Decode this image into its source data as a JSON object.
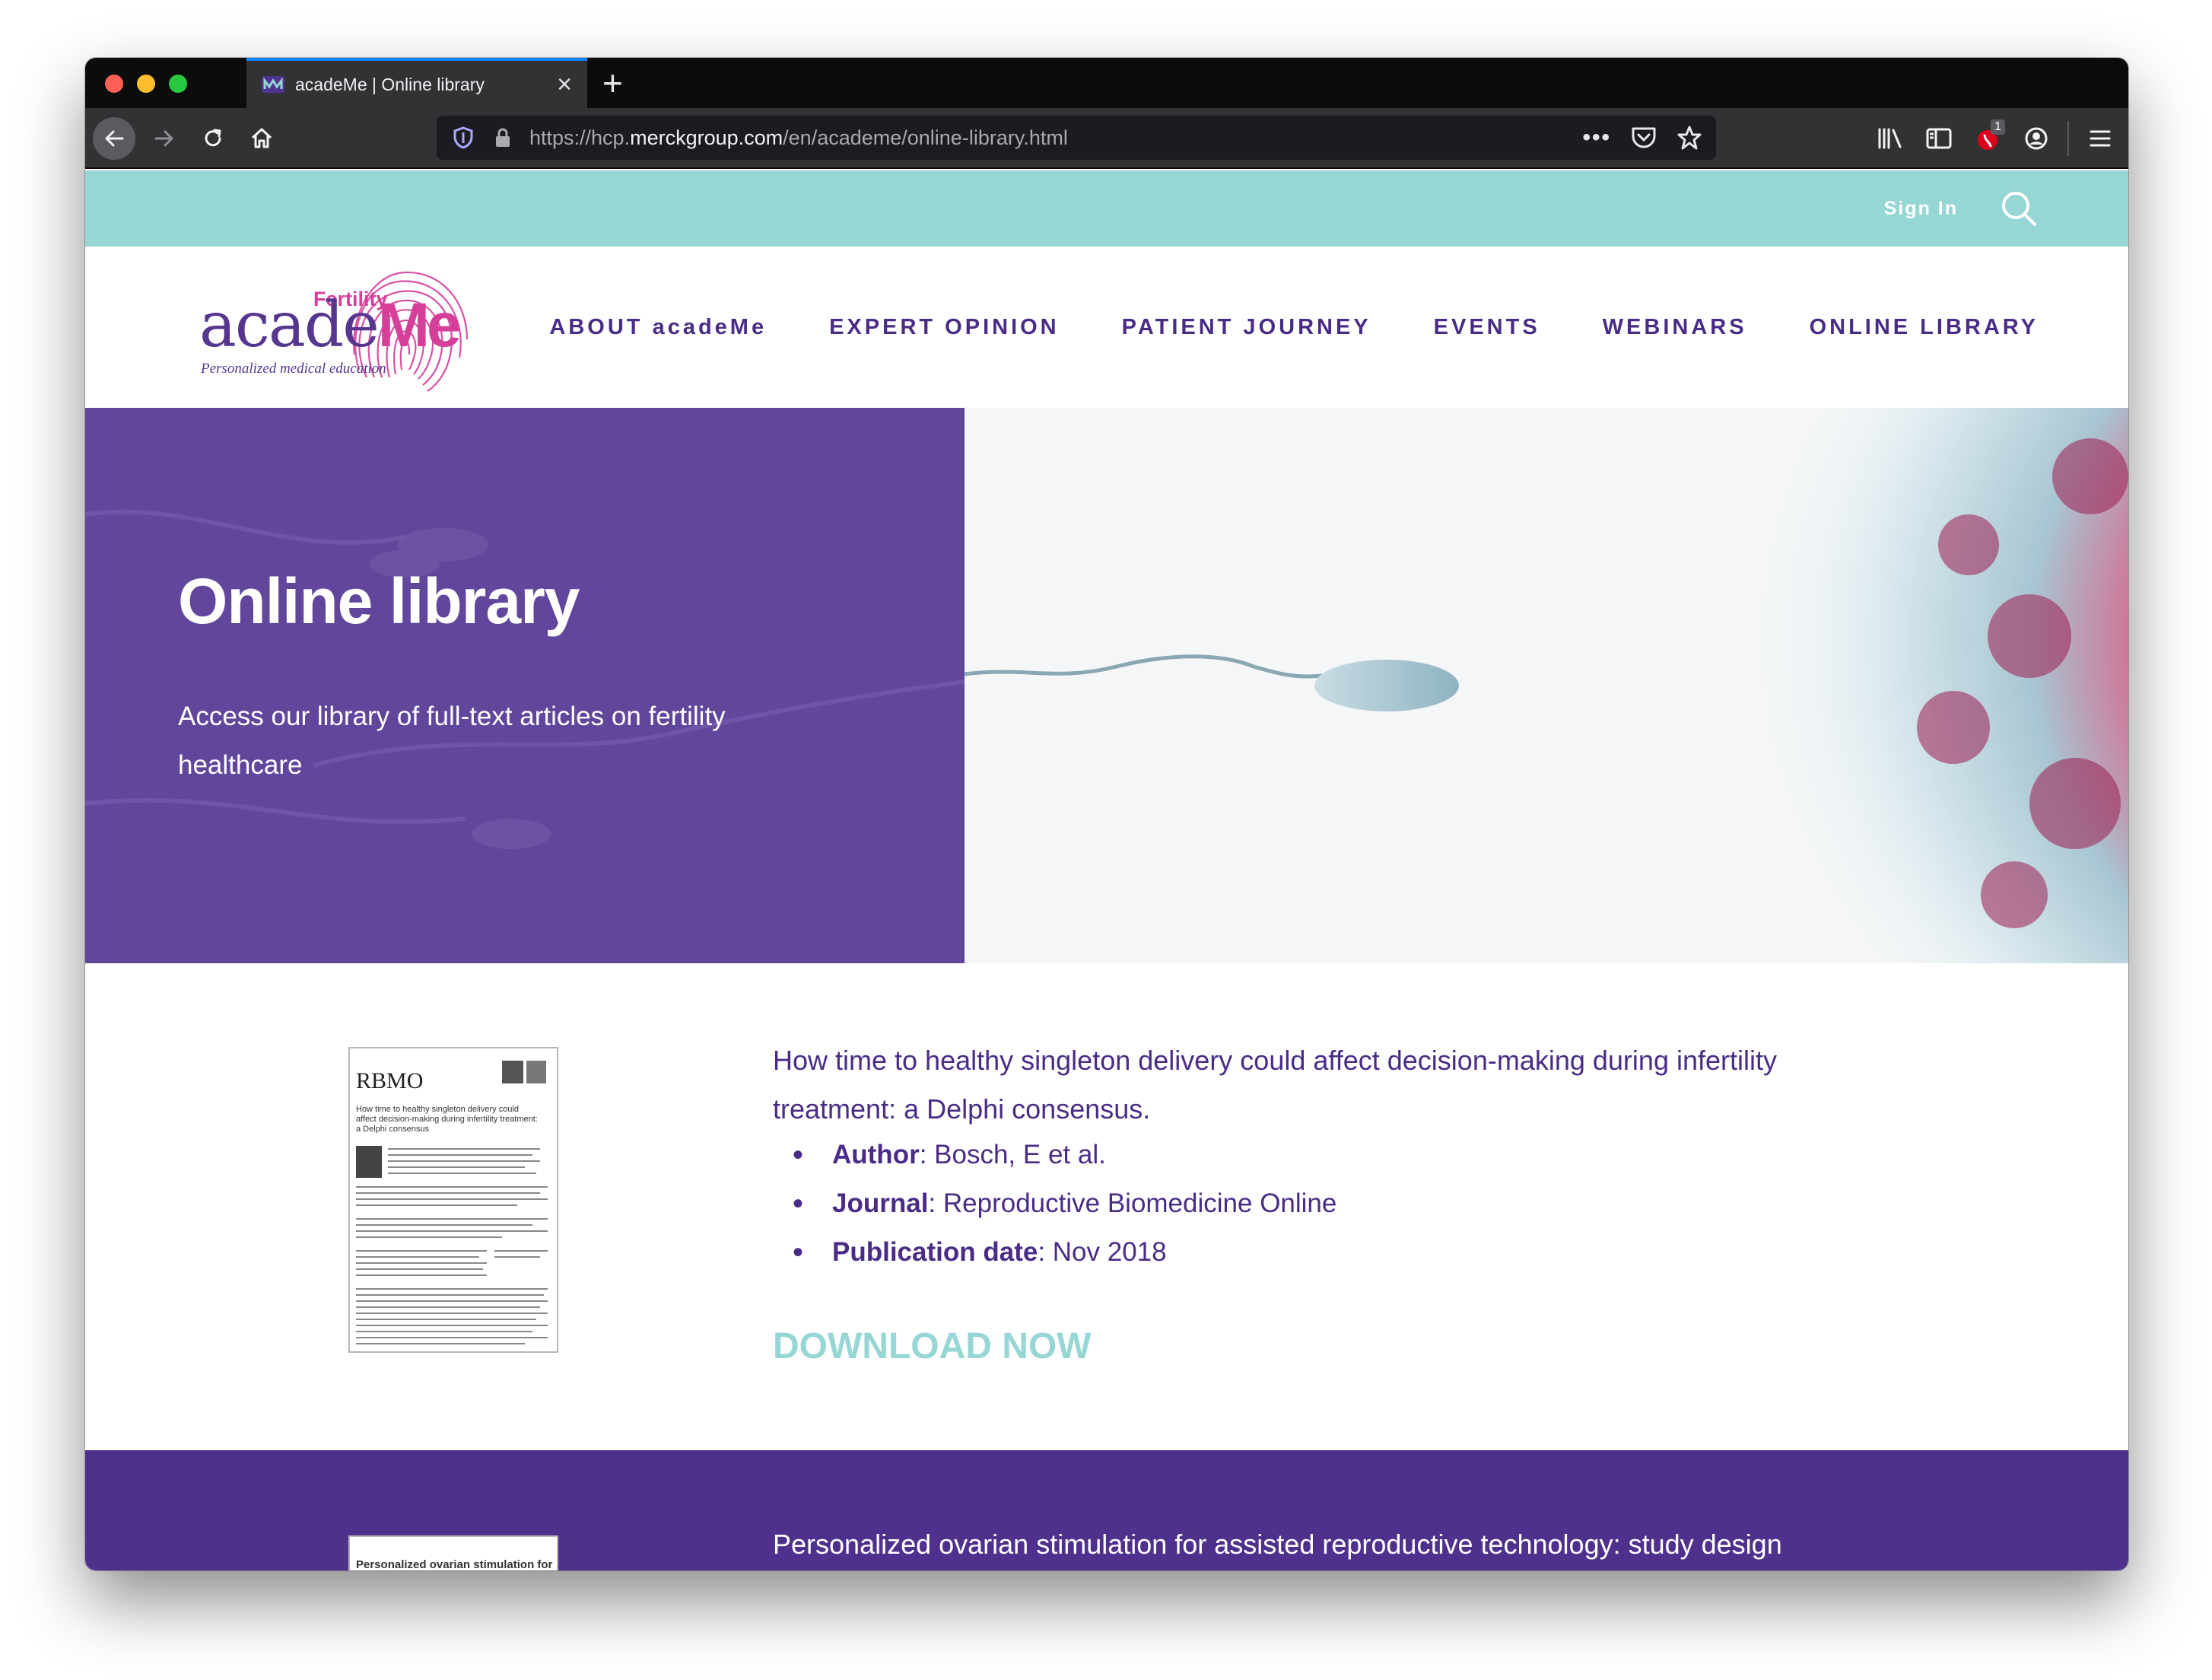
{
  "browser": {
    "tab_title": "acadeMe | Online library",
    "new_tab_label": "+",
    "url_prefix": "https://hcp.",
    "url_domain": "merckgroup.com",
    "url_path": "/en/academe/online-library.html",
    "url_more": "•••",
    "extension_badge": "1"
  },
  "site": {
    "sign_in": "Sign In",
    "logo": {
      "fertility": "Fertility",
      "acade": "acade",
      "me": "Me",
      "tagline": "Personalized medical education"
    },
    "nav": [
      {
        "label": "ABOUT acadeMe"
      },
      {
        "label": "EXPERT OPINION"
      },
      {
        "label": "PATIENT JOURNEY"
      },
      {
        "label": "EVENTS"
      },
      {
        "label": "WEBINARS"
      },
      {
        "label": "ONLINE LIBRARY"
      }
    ]
  },
  "hero": {
    "title": "Online library",
    "subtitle": "Access our library of full-text articles on fertility healthcare"
  },
  "articles": [
    {
      "cover_journal": "RBMO",
      "cover_title": "How time to healthy singleton delivery could affect decision-making during infertility treatment: a Delphi consensus",
      "title": "How time to healthy singleton delivery could affect decision-making during infertility treatment: a Delphi consensus.",
      "author_label": "Author",
      "author": ": Bosch, E et al.",
      "journal_label": "Journal",
      "journal": ": Reproductive Biomedicine Online",
      "date_label": "Publication date",
      "date": ": Nov 2018",
      "download": "DOWNLOAD NOW"
    },
    {
      "cover_title": "Personalized ovarian stimulation for",
      "title": "Personalized ovarian stimulation for assisted reproductive technology: study design"
    }
  ],
  "colors": {
    "purple_dark": "#4a2b86",
    "purple_hero": "#62469c",
    "purple_band": "#4f318d",
    "teal": "#96d6d4",
    "pink": "#d53f9a"
  }
}
